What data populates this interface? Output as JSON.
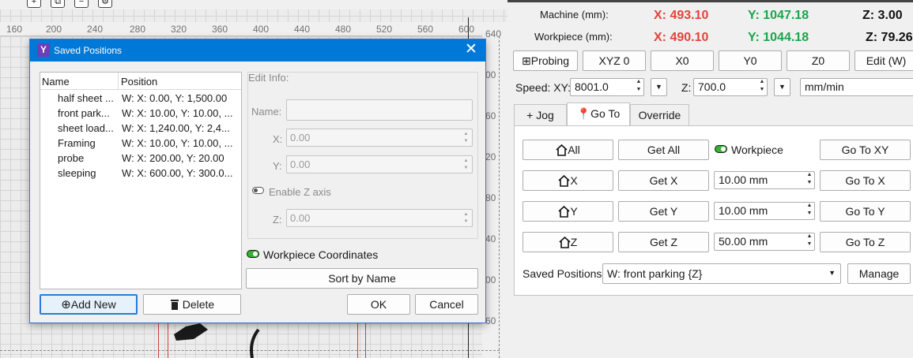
{
  "canvas": {
    "ruler_x": [
      "160",
      "200",
      "240",
      "280",
      "320",
      "360",
      "400",
      "440",
      "480",
      "520",
      "560",
      "600"
    ],
    "ruler_y": [
      "640",
      "00",
      "60",
      "20",
      "80",
      "40",
      "00",
      "60"
    ]
  },
  "dialog": {
    "title": "Saved Positions",
    "list": {
      "col_name": "Name",
      "col_position": "Position",
      "rows": [
        {
          "name": "half sheet ...",
          "position": "W: X: 0.00, Y: 1,500.00"
        },
        {
          "name": "front park...",
          "position": "W: X: 10.00, Y: 10.00, ..."
        },
        {
          "name": "sheet load...",
          "position": "W: X: 1,240.00, Y: 2,4..."
        },
        {
          "name": "Framing",
          "position": "W: X: 10.00, Y: 10.00, ..."
        },
        {
          "name": "probe",
          "position": "W: X: 200.00, Y: 20.00"
        },
        {
          "name": "sleeping",
          "position": "W: X: 600.00, Y: 300.0..."
        }
      ]
    },
    "edit_info": {
      "title": "Edit Info:",
      "name_label": "Name:",
      "x_label": "X:",
      "x_value": "0.00",
      "y_label": "Y:",
      "y_value": "0.00",
      "enable_z_label": "Enable Z axis",
      "z_label": "Z:",
      "z_value": "0.00"
    },
    "workpiece_coords_label": "Workpiece Coordinates",
    "sort_button": "Sort by Name",
    "add_button": "Add New",
    "delete_button": "Delete",
    "ok_button": "OK",
    "cancel_button": "Cancel"
  },
  "panel": {
    "machine_label": "Machine (mm):",
    "machine_x": "X: 493.10",
    "machine_y": "Y: 1047.18",
    "machine_z": "Z: 3.00",
    "workpiece_label": "Workpiece (mm):",
    "workpiece_x": "X: 490.10",
    "workpiece_y": "Y: 1044.18",
    "workpiece_z": "Z: 79.26",
    "buttons": {
      "probing": "Probing",
      "xyz0": "XYZ 0",
      "x0": "X0",
      "y0": "Y0",
      "z0": "Z0",
      "edit": "Edit (W)"
    },
    "speed_xy_label": "Speed: XY:",
    "speed_xy_value": "8001.0",
    "speed_z_label": "Z:",
    "speed_z_value": "700.0",
    "units": "mm/min",
    "tabs": {
      "jog": "Jog",
      "goto": "Go To",
      "override": "Override"
    },
    "goto": {
      "all": "All",
      "get_all": "Get All",
      "workpiece_toggle": "Workpiece",
      "go_xy": "Go To XY",
      "home_x": "X",
      "get_x": "Get X",
      "x_value": "10.00 mm",
      "go_x": "Go To X",
      "home_y": "Y",
      "get_y": "Get Y",
      "y_value": "10.00 mm",
      "go_y": "Go To Y",
      "home_z": "Z",
      "get_z": "Get Z",
      "z_value": "50.00 mm",
      "go_z": "Go To Z",
      "saved_positions_label": "Saved Positions",
      "saved_positions_value": "W: front parking {Z}",
      "manage": "Manage"
    }
  },
  "colors": {
    "accent": "#0078d7",
    "x_red": "#e0453b",
    "y_green": "#1aa64a",
    "toggle_green": "#2fb532"
  }
}
